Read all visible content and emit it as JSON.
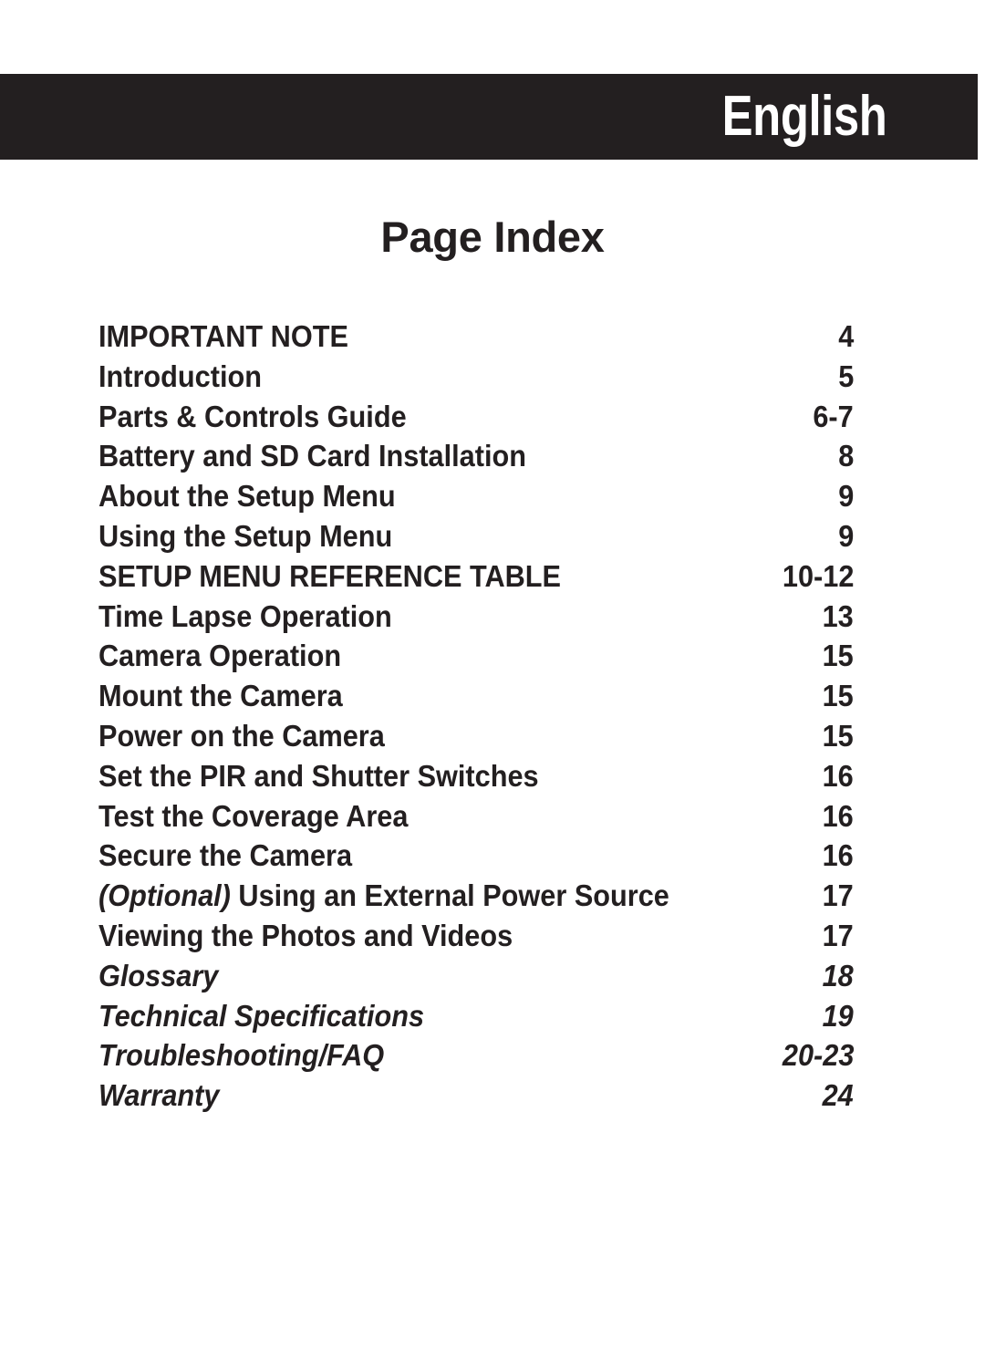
{
  "header": {
    "language_label": "English",
    "bar_color": "#231f20",
    "text_color": "#ffffff"
  },
  "page": {
    "title": "Page Index",
    "background_color": "#ffffff",
    "text_color": "#231f20"
  },
  "index": {
    "entries": [
      {
        "title": "IMPORTANT NOTE",
        "page": "4",
        "style": "caps"
      },
      {
        "title": "Introduction",
        "page": "5",
        "style": "regular"
      },
      {
        "title": "Parts & Controls Guide",
        "page": "6-7",
        "style": "regular"
      },
      {
        "title": "Battery and SD Card Installation",
        "page": "8",
        "style": "regular"
      },
      {
        "title": "About the Setup Menu",
        "page": "9",
        "style": "regular"
      },
      {
        "title": "Using the Setup Menu",
        "page": "9",
        "style": "regular"
      },
      {
        "title": "SETUP MENU REFERENCE TABLE",
        "page": "10-12",
        "style": "caps"
      },
      {
        "title": "Time Lapse Operation",
        "page": "13",
        "style": "regular"
      },
      {
        "title": "Camera Operation",
        "page": "15",
        "style": "regular"
      },
      {
        "title": "Mount the Camera",
        "page": "15",
        "style": "regular"
      },
      {
        "title": "Power on the Camera",
        "page": "15",
        "style": "regular"
      },
      {
        "title": "Set the PIR and Shutter Switches",
        "page": "16",
        "style": "regular"
      },
      {
        "title": "Test the Coverage Area",
        "page": "16",
        "style": "regular"
      },
      {
        "title": "Secure the Camera",
        "page": "16",
        "style": "regular"
      },
      {
        "title": "(Optional) Using an External Power Source",
        "page": "17",
        "style": "partial-italic",
        "italic_lead": "(Optional)",
        "regular_rest": " Using an External Power Source"
      },
      {
        "title": "Viewing the Photos and Videos",
        "page": "17",
        "style": "regular"
      },
      {
        "title": "Glossary",
        "page": "18",
        "style": "italic"
      },
      {
        "title": "Technical Specifications",
        "page": "19",
        "style": "italic"
      },
      {
        "title": "Troubleshooting/FAQ",
        "page": "20-23",
        "style": "italic"
      },
      {
        "title": "Warranty",
        "page": "24",
        "style": "italic"
      }
    ]
  }
}
